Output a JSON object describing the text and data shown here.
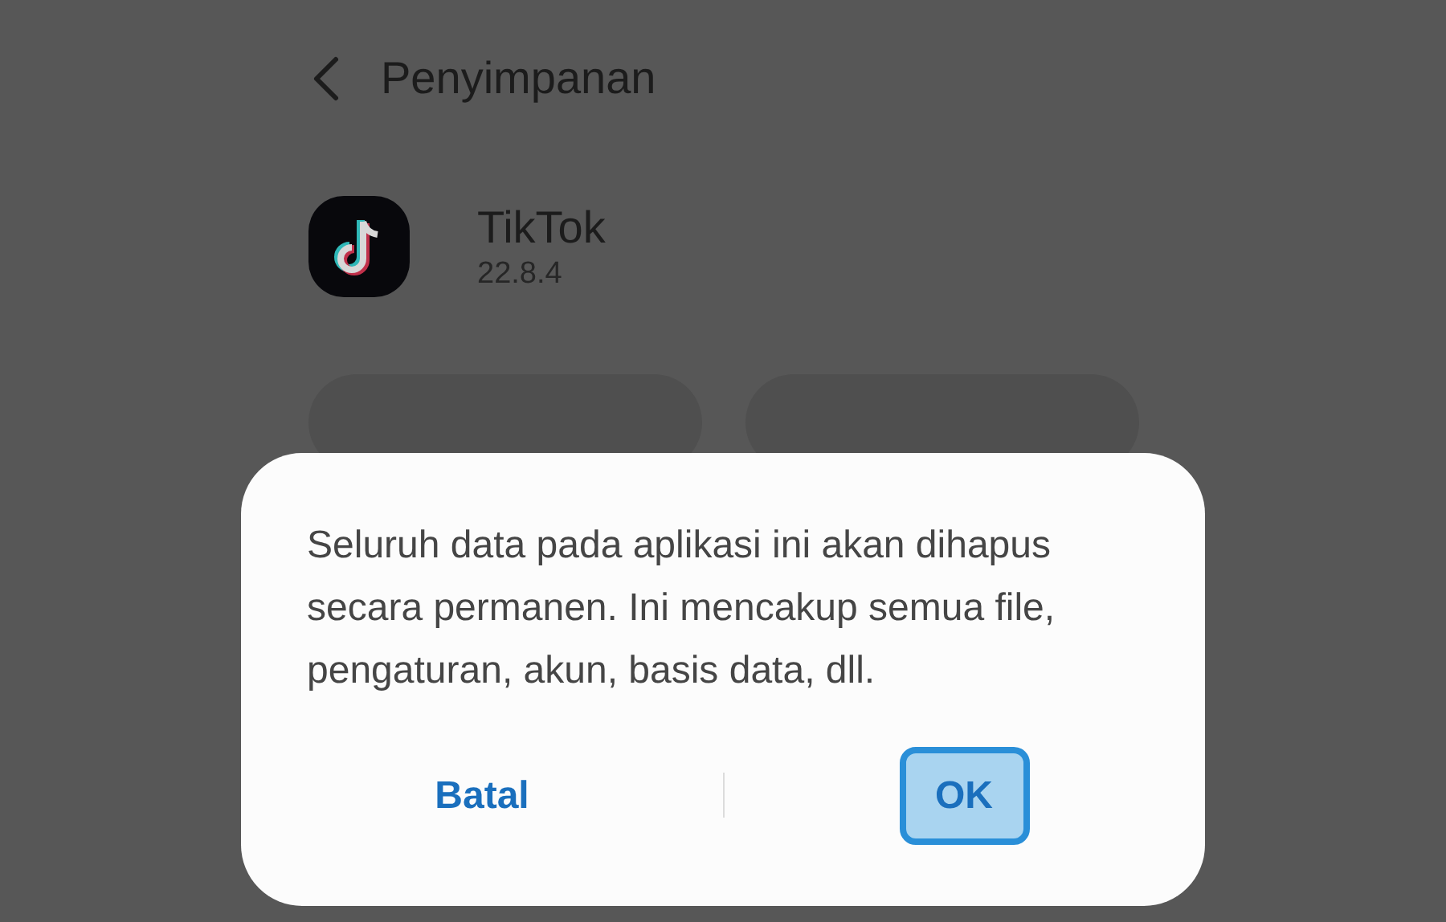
{
  "header": {
    "title": "Penyimpanan"
  },
  "app": {
    "name": "TikTok",
    "version": "22.8.4"
  },
  "background_buttons": [
    {
      "kind": "pill"
    },
    {
      "kind": "pill"
    }
  ],
  "dialog": {
    "message": "Seluruh data pada aplikasi ini akan dihapus secara permanen. Ini mencakup semua file, pengaturan, akun, basis data, dll.",
    "buttons": [
      {
        "label": "Batal",
        "focused": false
      },
      {
        "label": "OK",
        "focused": true
      }
    ]
  }
}
